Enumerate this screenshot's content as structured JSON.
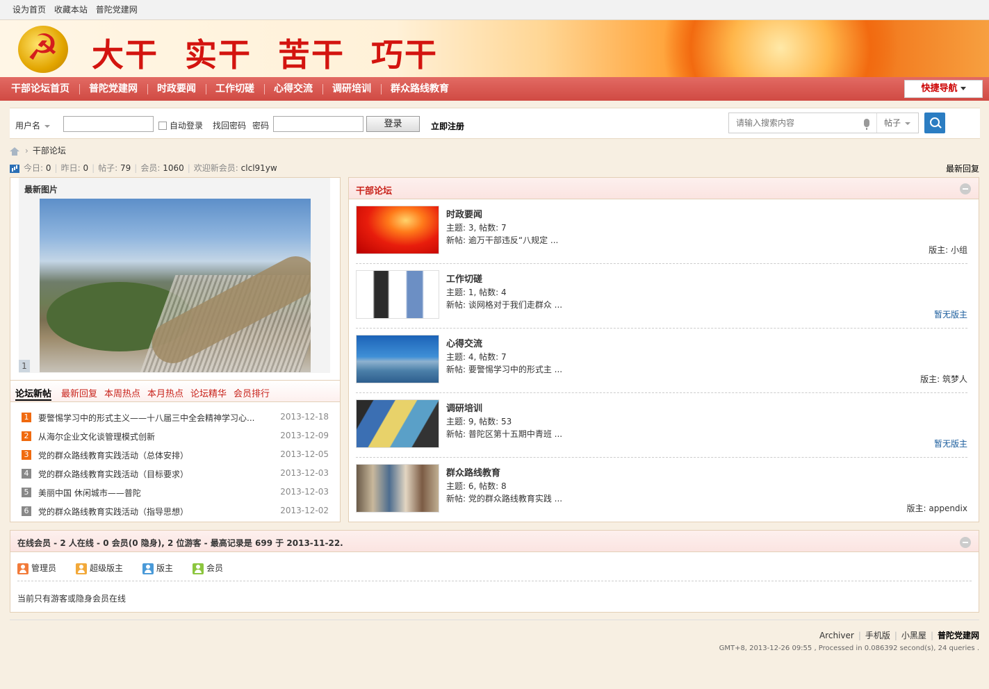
{
  "topbar": {
    "links": [
      "设为首页",
      "收藏本站",
      "普陀党建网"
    ]
  },
  "banner": {
    "slogans": [
      "大干",
      "实干",
      "苦干",
      "巧干"
    ]
  },
  "nav": {
    "items": [
      "干部论坛首页",
      "普陀党建网",
      "时政要闻",
      "工作切磋",
      "心得交流",
      "调研培训",
      "群众路线教育"
    ],
    "quick_nav": "快捷导航"
  },
  "login": {
    "username_label": "用户名",
    "auto_login": "自动登录",
    "find_password": "找回密码",
    "password_label": "密码",
    "login_button": "登录",
    "register": "立即注册"
  },
  "search": {
    "placeholder": "请输入搜索内容",
    "type": "帖子"
  },
  "breadcrumb": {
    "current": "干部论坛"
  },
  "stats": {
    "today_label": "今日:",
    "today": "0",
    "yesterday_label": "昨日:",
    "yesterday": "0",
    "posts_label": "帖子:",
    "posts": "79",
    "members_label": "会员:",
    "members": "1060",
    "welcome_label": "欢迎新会员:",
    "newest": "clcl91yw",
    "latest_reply": "最新回复"
  },
  "pictures": {
    "title": "最新图片",
    "index": "1"
  },
  "tabs": [
    "论坛新帖",
    "最新回复",
    "本周热点",
    "本月热点",
    "论坛精华",
    "会员排行"
  ],
  "threads": [
    {
      "num": "1",
      "title": "要警惕学习中的形式主义——十八届三中全会精神学习心...",
      "date": "2013-12-18"
    },
    {
      "num": "2",
      "title": "从海尔企业文化谈管理模式创新",
      "date": "2013-12-09"
    },
    {
      "num": "3",
      "title": "党的群众路线教育实践活动（总体安排）",
      "date": "2013-12-05"
    },
    {
      "num": "4",
      "title": "党的群众路线教育实践活动（目标要求）",
      "date": "2013-12-03"
    },
    {
      "num": "5",
      "title": "美丽中国 休闲城市——普陀",
      "date": "2013-12-03"
    },
    {
      "num": "6",
      "title": "党的群众路线教育实践活动（指导思想）",
      "date": "2013-12-02"
    }
  ],
  "forum_section": {
    "title": "干部论坛"
  },
  "forums": [
    {
      "name": "时政要闻",
      "counts": "主题: 3, 帖数: 7",
      "latest": "新帖: 逾万干部违反“八规定 ...",
      "moderator": "版主: 小组"
    },
    {
      "name": "工作切磋",
      "counts": "主题: 1, 帖数: 4",
      "latest": "新帖: 谈网格对于我们走群众 ...",
      "moderator": "暂无版主"
    },
    {
      "name": "心得交流",
      "counts": "主题: 4, 帖数: 7",
      "latest": "新帖: 要警惕学习中的形式主 ...",
      "moderator": "版主: 筑梦人"
    },
    {
      "name": "调研培训",
      "counts": "主题: 9, 帖数: 53",
      "latest": "新帖: 普陀区第十五期中青班 ...",
      "moderator": "暂无版主"
    },
    {
      "name": "群众路线教育",
      "counts": "主题: 6, 帖数: 8",
      "latest": "新帖: 党的群众路线教育实践 ...",
      "moderator": "版主: appendix"
    }
  ],
  "online": {
    "title": "在线会员 - 2 人在线 - 0 会员(0 隐身), 2 位游客 - 最高记录是 699 于 2013-11-22.",
    "legend": [
      "管理员",
      "超级版主",
      "版主",
      "会员"
    ],
    "note": "当前只有游客或隐身会员在线"
  },
  "footer": {
    "links": [
      "Archiver",
      "手机版",
      "小黑屋"
    ],
    "site": "普陀党建网",
    "info": "GMT+8, 2013-12-26 09:55 , Processed in 0.086392 second(s), 24 queries ."
  },
  "colors": {
    "nav": "#d9534f",
    "accent_red": "#c8221a",
    "search_button": "#2b7dc2",
    "page_bg": "#f7efe2"
  }
}
